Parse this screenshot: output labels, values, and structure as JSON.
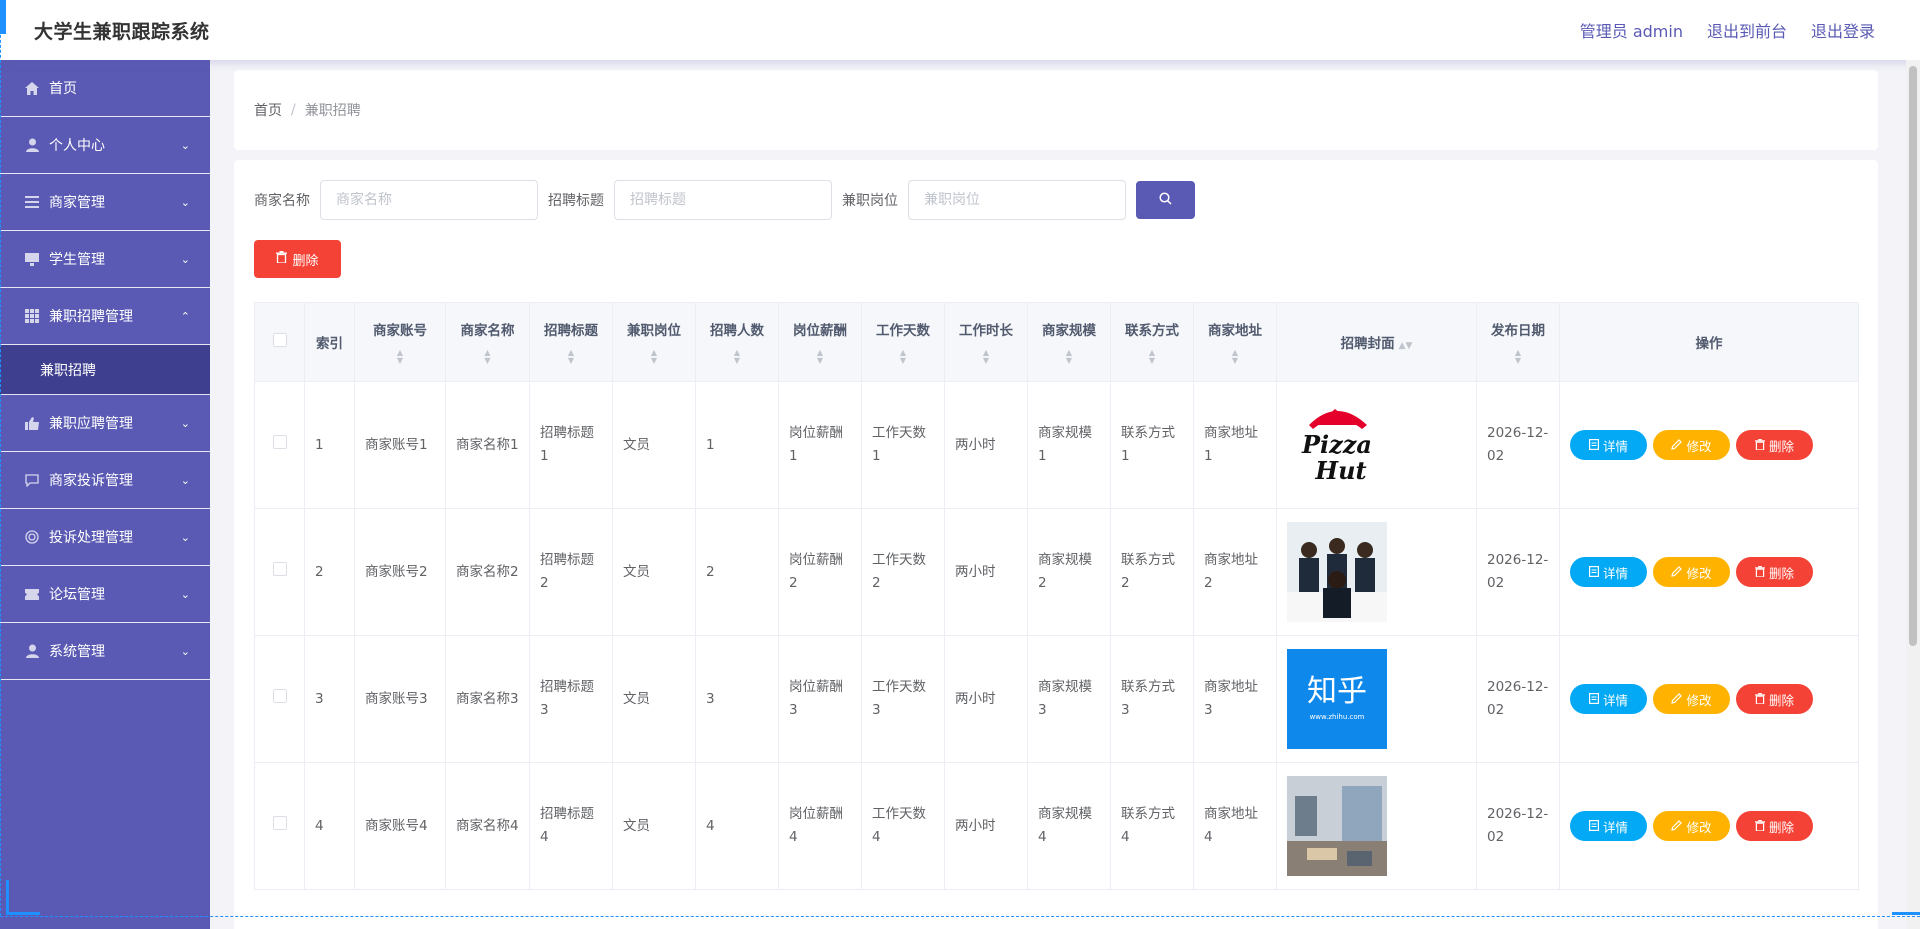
{
  "header": {
    "title": "大学生兼职跟踪系统",
    "links": [
      "管理员 admin",
      "退出到前台",
      "退出登录"
    ]
  },
  "sidebar": {
    "items": [
      {
        "label": "首页",
        "icon": "home-icon",
        "has_arrow": false
      },
      {
        "label": "个人中心",
        "icon": "user-icon",
        "has_arrow": true
      },
      {
        "label": "商家管理",
        "icon": "list-icon",
        "has_arrow": true
      },
      {
        "label": "学生管理",
        "icon": "monitor-icon",
        "has_arrow": true
      },
      {
        "label": "兼职招聘管理",
        "icon": "grid-icon",
        "has_arrow": true,
        "expanded": true
      },
      {
        "label": "兼职应聘管理",
        "icon": "thumb-icon",
        "has_arrow": true
      },
      {
        "label": "商家投诉管理",
        "icon": "chat-icon",
        "has_arrow": true
      },
      {
        "label": "投诉处理管理",
        "icon": "target-icon",
        "has_arrow": true
      },
      {
        "label": "论坛管理",
        "icon": "ticket-icon",
        "has_arrow": true
      },
      {
        "label": "系统管理",
        "icon": "user-icon",
        "has_arrow": true
      }
    ],
    "submenu": {
      "label": "兼职招聘"
    }
  },
  "breadcrumb": {
    "home": "首页",
    "separator": "/",
    "current": "兼职招聘"
  },
  "search": {
    "fields": [
      {
        "label": "商家名称",
        "placeholder": "商家名称"
      },
      {
        "label": "招聘标题",
        "placeholder": "招聘标题"
      },
      {
        "label": "兼职岗位",
        "placeholder": "兼职岗位"
      }
    ],
    "delete_label": "删除"
  },
  "table": {
    "columns": [
      "索引",
      "商家账号",
      "商家名称",
      "招聘标题",
      "兼职岗位",
      "招聘人数",
      "岗位薪酬",
      "工作天数",
      "工作时长",
      "商家规模",
      "联系方式",
      "商家地址",
      "招聘封面",
      "发布日期",
      "操作"
    ],
    "rows": [
      {
        "index": "1",
        "account": "商家账号1",
        "name": "商家名称1",
        "title": "招聘标题1",
        "post": "文员",
        "count": "1",
        "salary": "岗位薪酬1",
        "days": "工作天数1",
        "hours": "两小时",
        "scale": "商家规模1",
        "contact": "联系方式1",
        "address": "商家地址1",
        "cover": "pizza-hut-logo",
        "date": "2026-12-02"
      },
      {
        "index": "2",
        "account": "商家账号2",
        "name": "商家名称2",
        "title": "招聘标题2",
        "post": "文员",
        "count": "2",
        "salary": "岗位薪酬2",
        "days": "工作天数2",
        "hours": "两小时",
        "scale": "商家规模2",
        "contact": "联系方式2",
        "address": "商家地址2",
        "cover": "business-meeting-photo",
        "date": "2026-12-02"
      },
      {
        "index": "3",
        "account": "商家账号3",
        "name": "商家名称3",
        "title": "招聘标题3",
        "post": "文员",
        "count": "3",
        "salary": "岗位薪酬3",
        "days": "工作天数3",
        "hours": "两小时",
        "scale": "商家规模3",
        "contact": "联系方式3",
        "address": "商家地址3",
        "cover": "zhihu-logo",
        "cover_text": "知乎",
        "cover_url": "www.zhihu.com",
        "date": "2026-12-02"
      },
      {
        "index": "4",
        "account": "商家账号4",
        "name": "商家名称4",
        "title": "招聘标题4",
        "post": "文员",
        "count": "4",
        "salary": "岗位薪酬4",
        "days": "工作天数4",
        "hours": "两小时",
        "scale": "商家规模4",
        "contact": "联系方式4",
        "address": "商家地址4",
        "cover": "office-interior-photo",
        "date": "2026-12-02"
      }
    ],
    "actions": {
      "detail": "详情",
      "edit": "修改",
      "delete": "删除"
    }
  },
  "colors": {
    "primary": "#5a5ab4",
    "sidebar_active": "#3f3f8f",
    "danger": "#f44336",
    "info": "#03a9f4",
    "warning": "#ffb300"
  }
}
